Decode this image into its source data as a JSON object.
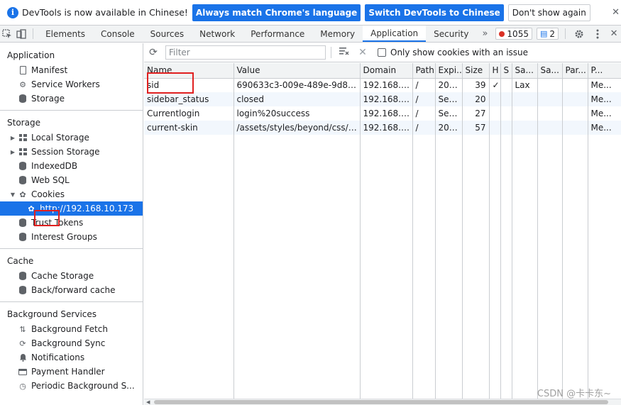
{
  "infobar": {
    "message": "DevTools is now available in Chinese!",
    "btn_match": "Always match Chrome's language",
    "btn_switch": "Switch DevTools to Chinese",
    "btn_dismiss": "Don't show again",
    "close": "✕"
  },
  "tabs": [
    "Elements",
    "Console",
    "Sources",
    "Network",
    "Performance",
    "Memory",
    "Application",
    "Security"
  ],
  "tabs_active": "Application",
  "tabs_more": "»",
  "badges": {
    "errors": "1055",
    "messages": "2"
  },
  "sidebar": {
    "application": {
      "title": "Application",
      "items": [
        "Manifest",
        "Service Workers",
        "Storage"
      ]
    },
    "storage": {
      "title": "Storage",
      "items": [
        "Local Storage",
        "Session Storage",
        "IndexedDB",
        "Web SQL",
        "Cookies"
      ],
      "cookie_origin": "http://192.168.10.173",
      "after": [
        "Trust Tokens",
        "Interest Groups"
      ]
    },
    "cache": {
      "title": "Cache",
      "items": [
        "Cache Storage",
        "Back/forward cache"
      ]
    },
    "background": {
      "title": "Background Services",
      "items": [
        "Background Fetch",
        "Background Sync",
        "Notifications",
        "Payment Handler",
        "Periodic Background S..."
      ]
    }
  },
  "toolbar": {
    "filter_placeholder": "Filter",
    "only_issue_label": "Only show cookies with an issue"
  },
  "table": {
    "columns": [
      "Name",
      "Value",
      "Domain",
      "Path",
      "Expi...",
      "Size",
      "H",
      "S",
      "Sa...",
      "Sa...",
      "Par...",
      "P..."
    ],
    "rows": [
      [
        "sid",
        "690633c3-009e-489e-9d85-e...",
        "192.168.1...",
        "/",
        "202...",
        "39",
        "✓",
        "",
        "Lax",
        "",
        "",
        "Me..."
      ],
      [
        "sidebar_status",
        "closed",
        "192.168.1...",
        "/",
        "Ses...",
        "20",
        "",
        "",
        "",
        "",
        "",
        "Me..."
      ],
      [
        "Currentlogin",
        "login%20success",
        "192.168.1...",
        "/",
        "Ses...",
        "27",
        "",
        "",
        "",
        "",
        "",
        "Me..."
      ],
      [
        "current-skin",
        "/assets/styles/beyond/css/ski...",
        "192.168.1...",
        "/",
        "202...",
        "57",
        "",
        "",
        "",
        "",
        "",
        "Me..."
      ]
    ]
  },
  "watermark": "CSDN @卡卡东~",
  "colors": {
    "accent": "#1a73e8",
    "error": "#d93025",
    "annotation": "#e02020"
  }
}
